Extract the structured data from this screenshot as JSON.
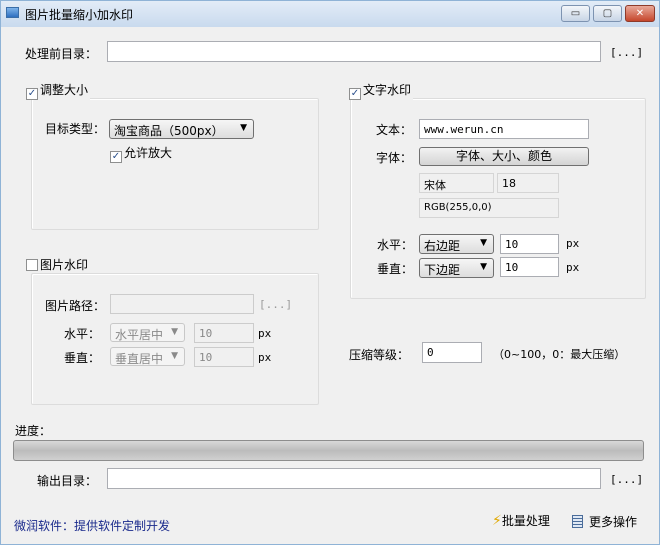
{
  "window": {
    "title": "图片批量缩小加水印",
    "minimize": "▭",
    "maximize": "▢",
    "close": "✕"
  },
  "source_dir": {
    "label": "处理前目录：",
    "value": "",
    "browse": "[...]"
  },
  "resize": {
    "label": "调整大小",
    "checked": true,
    "target_label": "目标类型：",
    "target_value": "淘宝商品（500px）",
    "allow_enlarge_label": "允许放大",
    "allow_enlarge_checked": true
  },
  "text_watermark": {
    "label": "文字水印",
    "checked": true,
    "text_label": "文本：",
    "text_value": "www.werun.cn",
    "font_label": "字体：",
    "font_button": "字体、大小、颜色",
    "font_name": "宋体",
    "font_size": "18",
    "font_color": "RGB(255,0,0)",
    "h_label": "水平：",
    "h_value": "右边距",
    "h_offset": "10",
    "v_label": "垂直：",
    "v_value": "下边距",
    "v_offset": "10",
    "unit": "px"
  },
  "image_watermark": {
    "label": "图片水印",
    "checked": false,
    "path_label": "图片路径：",
    "path_value": "",
    "browse": "[...]",
    "h_label": "水平：",
    "h_value": "水平居中",
    "h_offset": "10",
    "v_label": "垂直：",
    "v_value": "垂直居中",
    "v_offset": "10",
    "unit": "px"
  },
  "compression": {
    "label": "压缩等级：",
    "value": "0",
    "hint": "（0~100，0：最大压缩）"
  },
  "progress": {
    "label": "进度：",
    "percent": 0
  },
  "output_dir": {
    "label": "输出目录：",
    "value": "",
    "browse": "[...]"
  },
  "footer": {
    "link": "微润软件：提供软件定制开发",
    "batch": "批量处理",
    "more": "更多操作"
  }
}
